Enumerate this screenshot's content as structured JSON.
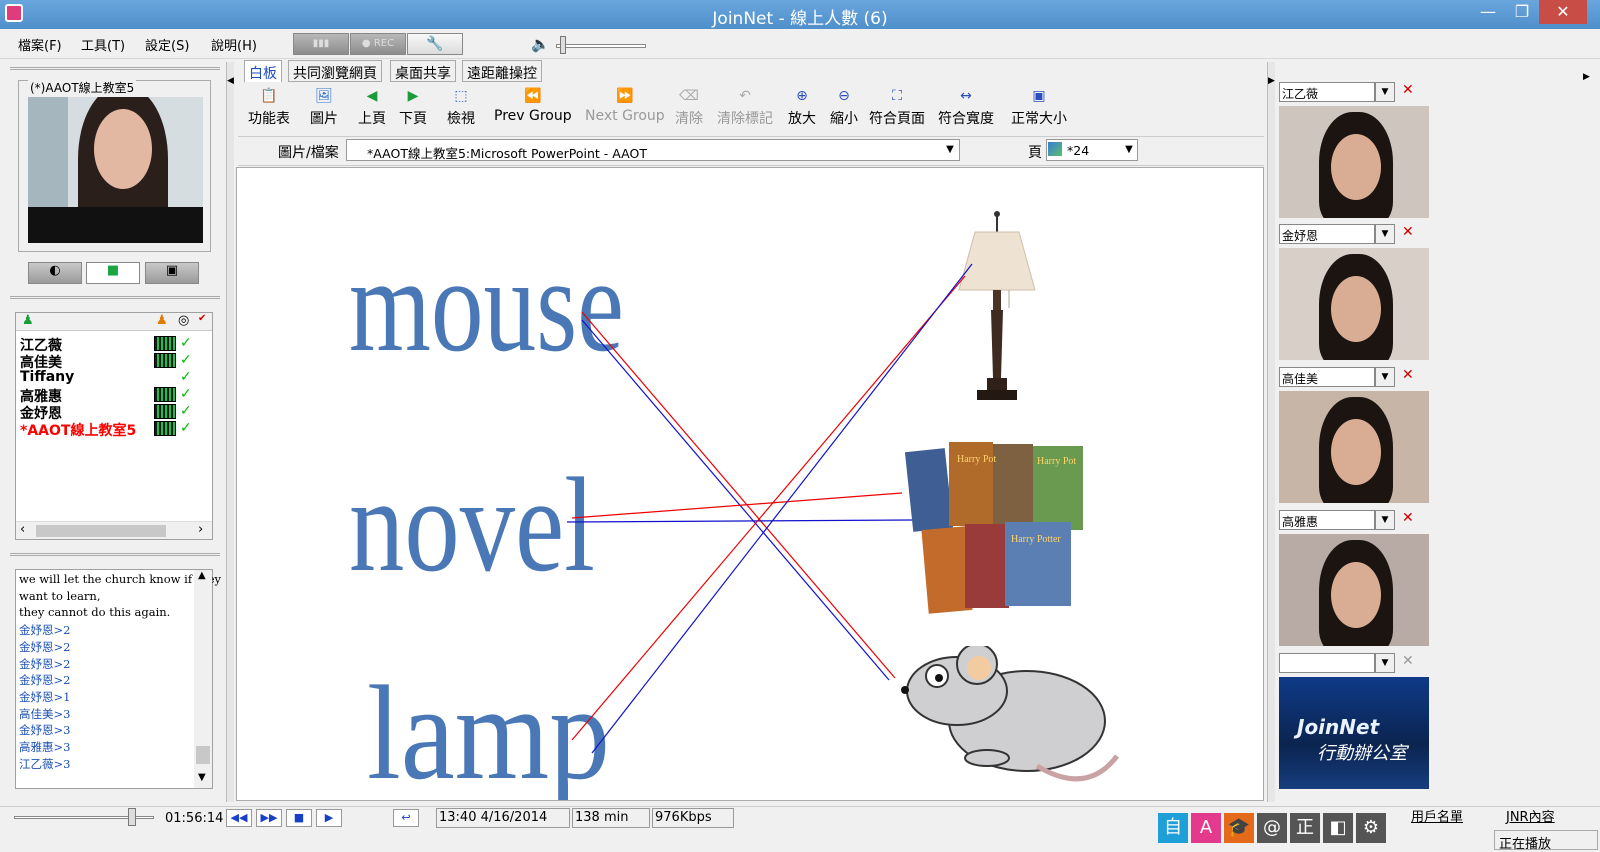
{
  "window": {
    "title": "JoinNet - 線上人數 (6)",
    "minimize": "—",
    "maximize": "❐",
    "close": "✕"
  },
  "menu": [
    "檔案(F)",
    "工具(T)",
    "設定(S)",
    "說明(H)"
  ],
  "toolbar_top": {
    "rec": "● REC"
  },
  "left": {
    "video_label": "(*)AAOT線上教室5",
    "users": [
      {
        "name": "江乙薇",
        "color": "#000000",
        "level": true
      },
      {
        "name": "高佳美",
        "color": "#000000",
        "level": true
      },
      {
        "name": "Tiffany",
        "color": "#000000",
        "level": false
      },
      {
        "name": "高雅惠",
        "color": "#000000",
        "level": true
      },
      {
        "name": "金妤恩",
        "color": "#000000",
        "level": true
      },
      {
        "name": "*AAOT線上教室5",
        "color": "#ff0000",
        "level": true
      }
    ],
    "chat": [
      {
        "text": "we will let the church know if they",
        "color": "#000000"
      },
      {
        "text": "want to learn,",
        "color": "#000000"
      },
      {
        "text": "they cannot do this again.",
        "color": "#000000"
      },
      {
        "text": "金妤恩>2",
        "color": "#1a4fb5"
      },
      {
        "text": "金妤恩>2",
        "color": "#1a4fb5"
      },
      {
        "text": "金妤恩>2",
        "color": "#1a4fb5"
      },
      {
        "text": "金妤恩>2",
        "color": "#1a4fb5"
      },
      {
        "text": "金妤恩>1",
        "color": "#1a4fb5"
      },
      {
        "text": "高佳美>3",
        "color": "#1a4fb5"
      },
      {
        "text": "金妤恩>3",
        "color": "#1a4fb5"
      },
      {
        "text": "高雅惠>3",
        "color": "#1a4fb5"
      },
      {
        "text": "江乙薇>3",
        "color": "#1a4fb5"
      }
    ]
  },
  "tabs": [
    "白板",
    "共同瀏覽網頁",
    "桌面共享",
    "遠距離操控"
  ],
  "tools": [
    {
      "label": "功能表",
      "icon": "clipboard-icon",
      "enabled": true
    },
    {
      "label": "圖片",
      "icon": "picture-icon",
      "enabled": true
    },
    {
      "label": "上頁",
      "icon": "prev-page-icon",
      "enabled": true
    },
    {
      "label": "下頁",
      "icon": "next-page-icon",
      "enabled": true
    },
    {
      "label": "檢視",
      "icon": "view-icon",
      "enabled": true
    },
    {
      "label": "Prev Group",
      "icon": "prev-group-icon",
      "enabled": true
    },
    {
      "label": "Next Group",
      "icon": "next-group-icon",
      "enabled": false
    },
    {
      "label": "清除",
      "icon": "clear-icon",
      "enabled": false
    },
    {
      "label": "清除標記",
      "icon": "clear-marks-icon",
      "enabled": false
    },
    {
      "label": "放大",
      "icon": "zoom-in-icon",
      "enabled": true
    },
    {
      "label": "縮小",
      "icon": "zoom-out-icon",
      "enabled": true
    },
    {
      "label": "符合頁面",
      "icon": "fit-page-icon",
      "enabled": true
    },
    {
      "label": "符合寬度",
      "icon": "fit-width-icon",
      "enabled": true
    },
    {
      "label": "正常大小",
      "icon": "actual-size-icon",
      "enabled": true
    }
  ],
  "file_bar": {
    "label": "圖片/檔案",
    "value": "*AAOT線上教室5:Microsoft PowerPoint - AAOT",
    "page_label": "頁",
    "page_value": "*24"
  },
  "board": {
    "words": [
      "mouse",
      "novel",
      "lamp"
    ]
  },
  "right": {
    "videos": [
      {
        "name": "江乙薇"
      },
      {
        "name": "金妤恩"
      },
      {
        "name": "高佳美"
      },
      {
        "name": "高雅惠"
      },
      {
        "name": ""
      }
    ],
    "logo_title": "JoinNet",
    "logo_sub": "行動辦公室"
  },
  "status": {
    "elapsed": "01:56:14",
    "datetime": "13:40 4/16/2014",
    "duration": "138 min",
    "bitrate": "976Kbps",
    "ime": [
      "自",
      "A",
      "🎓",
      "@",
      "正",
      "◧",
      "⚙"
    ],
    "user_list_link": "用戶名單",
    "jnr_link": "JNR內容",
    "playing": "正在播放"
  }
}
